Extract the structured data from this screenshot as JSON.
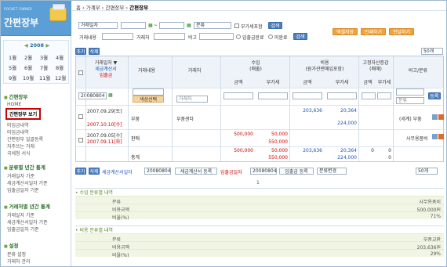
{
  "sidebar": {
    "logo_small": "POCKET OWNER",
    "logo_big": "간편장부",
    "year": "2008",
    "year_prev": "◀",
    "year_next": "▶",
    "months": [
      "1월",
      "2월",
      "3월",
      "4월",
      "5월",
      "6월",
      "7월",
      "8월",
      "9월",
      "10월",
      "11월",
      "12월"
    ],
    "section1": "간편장부",
    "items1": [
      "HOME",
      "간편장부 보기",
      "미입금내역",
      "미입금내역",
      "간편장부 일괄등록",
      "자주쓰는 거래",
      "국세청 서식"
    ],
    "section2": "분류별 년간 통계",
    "items2": [
      "거래일자 기준",
      "세금계산서일자 기준",
      "입출금일자 기준"
    ],
    "section3": "거래처별 년간 통계",
    "items3": [
      "거래일자 기준",
      "세금계산서일자 기준",
      "입출금일자 기준"
    ],
    "section4": "설정",
    "items4": [
      "분류 설정",
      "거래처 관리"
    ]
  },
  "breadcrumb": {
    "home": "홈",
    "sep": "›",
    "c1": "가계부",
    "c2": "간편장부",
    "c3": "간편장부"
  },
  "filter": {
    "date_type": "거래일자",
    "sep": "~",
    "category": "분류",
    "vat_label": "부가세포함",
    "search": "검색",
    "desc_label": "거래내용",
    "partner_label": "거래처",
    "memo_label": "비고",
    "paid_label": "입출금완료",
    "unpaid_label": "미완료",
    "search2": "검색",
    "excel": "엑셀저장",
    "print": "인쇄하기",
    "help": "전달하기"
  },
  "toolbar": {
    "add": "추가",
    "del": "삭제",
    "pagesize": "50개"
  },
  "table": {
    "h_date": "거래일자 ▼",
    "h_tax": "세금계산서",
    "h_pay": "입출금",
    "h_desc": "거래내용",
    "h_partner": "거래처",
    "h_income": "수입",
    "h_income_sub": "(매출)",
    "h_expense": "비용",
    "h_expense_sub": "(원가관련매입포함)",
    "h_asset": "고정자산증감",
    "h_asset_sub": "(매매)",
    "h_note": "비고/분류",
    "h_amt": "금액",
    "h_vat": "부가세",
    "new_date": "20080804",
    "color_btn": "색상선택",
    "partner_ph": "거래처",
    "cat_ph": "분류",
    "reg": "등록",
    "rows": [
      {
        "d1": "2007.09.29[토]",
        "d2": "2007.10.10[수]",
        "desc": "부품",
        "partner": "부품센타",
        "exp_amt": "203,636",
        "exp_vat": "20,364",
        "exp_total": "224,000",
        "note": "(세계) 부품"
      },
      {
        "d1": "2007.09.05[수]",
        "d2": "2007.09.11[화]",
        "desc": "판매",
        "partner": "",
        "inc_amt": "500,000",
        "inc_vat": "50,000",
        "inc_total": "550,000",
        "note": "사무용품비"
      }
    ],
    "total_label": "총계",
    "tot_inc_amt": "500,000",
    "tot_inc_vat": "50,000",
    "tot_exp_amt": "203,636",
    "tot_exp_vat": "20,364",
    "tot_inc": "550,000",
    "tot_exp": "224,000",
    "tot_asset_amt": "0",
    "tot_asset_vat": "0",
    "tot_asset": "0"
  },
  "bottom": {
    "add": "추가",
    "del": "삭제",
    "taxdate_label": "세금계산서일자",
    "taxdate": "20080804",
    "taxreg": "세금계산서 등록",
    "paydate_label": "입출금일자",
    "paydate": "20080804",
    "payreg": "입출금 등록",
    "catchange": "분류변경",
    "pagesize": "50개",
    "page": "1"
  },
  "summary": {
    "inc_head": "수입 분류별 내역",
    "inc": [
      {
        "k": "분류",
        "v": "사무용품비"
      },
      {
        "k": "비용금액",
        "v": "500,000원"
      },
      {
        "k": "비율(%)",
        "v": "71%"
      }
    ],
    "exp_head": "비용 분류별 내역",
    "exp": [
      {
        "k": "분류",
        "v": "부품교환"
      },
      {
        "k": "비용금액",
        "v": "203,636원"
      },
      {
        "k": "비율(%)",
        "v": "29%"
      }
    ]
  }
}
